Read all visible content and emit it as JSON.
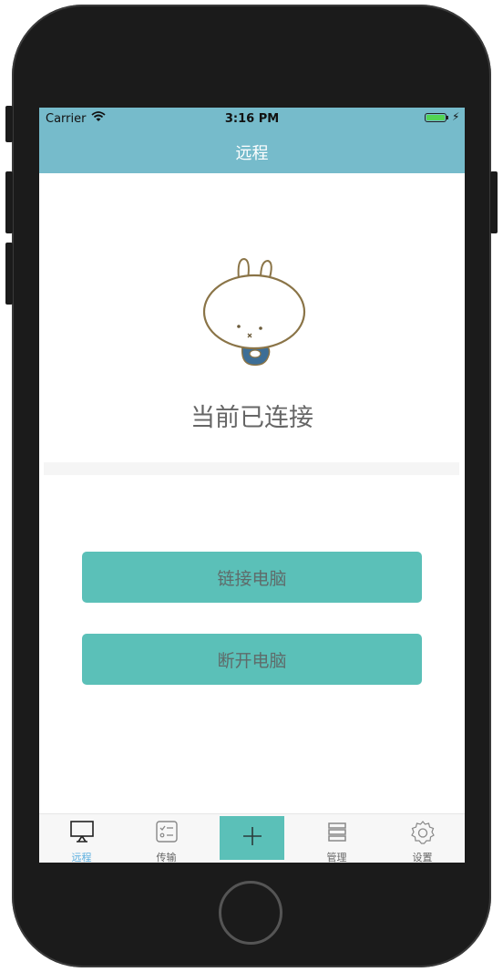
{
  "status_bar": {
    "carrier": "Carrier",
    "time": "3:16 PM",
    "battery_color": "#52d453"
  },
  "nav": {
    "title": "远程",
    "background": "#76bbcb"
  },
  "main": {
    "connection_status": "当前已连接",
    "mascot_icon": "rabbit-mascot-icon"
  },
  "actions": {
    "connect_label": "链接电脑",
    "disconnect_label": "断开电脑",
    "button_color": "#5bc0b8"
  },
  "tabbar": {
    "tabs": [
      {
        "label": "远程",
        "icon": "monitor-icon",
        "active": true
      },
      {
        "label": "传输",
        "icon": "checklist-icon",
        "active": false
      },
      {
        "label": "",
        "icon": "plus-icon",
        "active": false
      },
      {
        "label": "管理",
        "icon": "stack-icon",
        "active": false
      },
      {
        "label": "设置",
        "icon": "gear-icon",
        "active": false
      }
    ],
    "active_color": "#5aaee0"
  }
}
